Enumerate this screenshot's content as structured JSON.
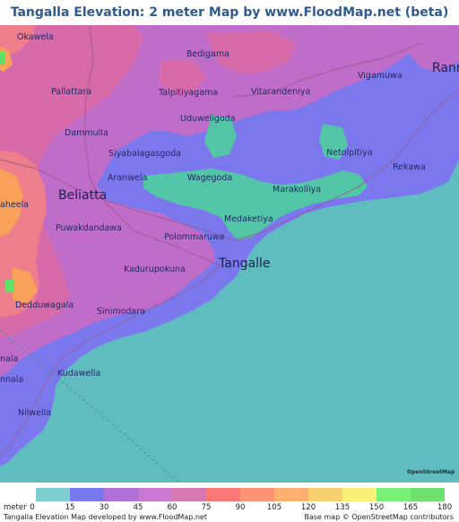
{
  "title": "Tangalla Elevation: 2 meter Map by www.FloodMap.net (beta)",
  "map": {
    "places": [
      {
        "name": "Okawela",
        "size": "normal"
      },
      {
        "name": "Bedigama",
        "size": "normal"
      },
      {
        "name": "Rann",
        "size": "large"
      },
      {
        "name": "Pallattara",
        "size": "normal"
      },
      {
        "name": "Talpitiyagama",
        "size": "normal"
      },
      {
        "name": "Vitarandeniya",
        "size": "normal"
      },
      {
        "name": "Vigamuwa",
        "size": "normal"
      },
      {
        "name": "Uduweligoda",
        "size": "normal"
      },
      {
        "name": "Dammulla",
        "size": "normal"
      },
      {
        "name": "Siyabalagasgoda",
        "size": "normal"
      },
      {
        "name": "Netolpitiya",
        "size": "normal"
      },
      {
        "name": "Aranwela",
        "size": "normal"
      },
      {
        "name": "Wagegoda",
        "size": "normal"
      },
      {
        "name": "Rekawa",
        "size": "normal"
      },
      {
        "name": "Beliatta",
        "size": "large"
      },
      {
        "name": "Marakolliya",
        "size": "normal"
      },
      {
        "name": "aheela",
        "size": "normal"
      },
      {
        "name": "Medaketiya",
        "size": "normal"
      },
      {
        "name": "Puwakdandawa",
        "size": "normal"
      },
      {
        "name": "Polommaruwa",
        "size": "normal"
      },
      {
        "name": "Tangalle",
        "size": "large"
      },
      {
        "name": "Kadurupokuna",
        "size": "normal"
      },
      {
        "name": "Dedduwagala",
        "size": "normal"
      },
      {
        "name": "Sinimodara",
        "size": "normal"
      },
      {
        "name": "nala",
        "size": "normal"
      },
      {
        "name": "Kudawella",
        "size": "normal"
      },
      {
        "name": "nnala",
        "size": "normal"
      },
      {
        "name": "Nilwella",
        "size": "normal"
      }
    ]
  },
  "osm_badge": "OpenStreetMap",
  "legend": {
    "unit": "meter",
    "ticks": [
      "0",
      "15",
      "30",
      "45",
      "60",
      "75",
      "90",
      "105",
      "120",
      "135",
      "150",
      "165",
      "180"
    ],
    "colors": [
      "#7ecfcf",
      "#7878f0",
      "#b070d8",
      "#c878d0",
      "#d878b0",
      "#ff7878",
      "#ff9474",
      "#ffb070",
      "#f8d070",
      "#f8f078",
      "#78f078",
      "#70e070"
    ]
  },
  "footer": {
    "left": "Tangalla Elevation Map developed by www.FloodMap.net",
    "right": "Base map © OpenStreetMap contributors"
  },
  "colors": {
    "sea": "#5fbcbf",
    "coastal_lowland": "#7b78ee",
    "midland": "#c06cc9",
    "upland": "#d76aa9",
    "hills": "#ee7e8c",
    "peaks": "#f7a15b",
    "wetland": "#54c6a8",
    "title": "#2f5a8f"
  }
}
